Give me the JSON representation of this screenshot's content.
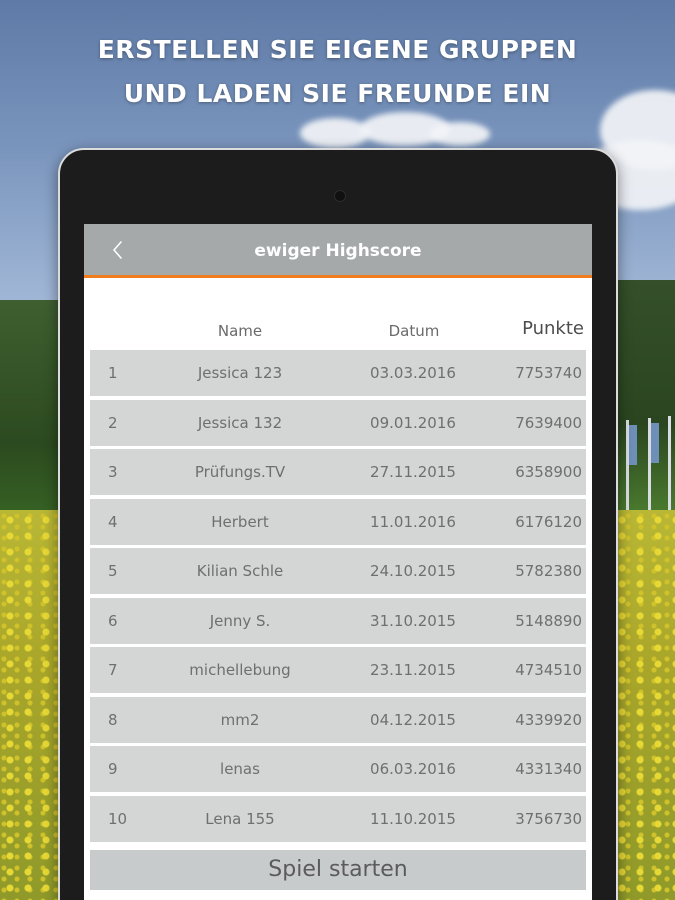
{
  "headline": {
    "line1": "ERSTELLEN SIE EIGENE GRUPPEN",
    "line2": "UND LADEN SIE FREUNDE EIN"
  },
  "appbar": {
    "title": "ewiger Highscore",
    "back_icon": "chevron-left-icon"
  },
  "table": {
    "columns": {
      "name": "Name",
      "date": "Datum",
      "points": "Punkte"
    },
    "rows": [
      {
        "rank": "1",
        "name": "Jessica 123",
        "date": "03.03.2016",
        "points": "7753740"
      },
      {
        "rank": "2",
        "name": "Jessica 132",
        "date": "09.01.2016",
        "points": "7639400"
      },
      {
        "rank": "3",
        "name": "Prüfungs.TV",
        "date": "27.11.2015",
        "points": "6358900"
      },
      {
        "rank": "4",
        "name": "Herbert",
        "date": "11.01.2016",
        "points": "6176120"
      },
      {
        "rank": "5",
        "name": "Kilian Schle",
        "date": "24.10.2015",
        "points": "5782380"
      },
      {
        "rank": "6",
        "name": "Jenny S.",
        "date": "31.10.2015",
        "points": "5148890"
      },
      {
        "rank": "7",
        "name": "michellebung",
        "date": "23.11.2015",
        "points": "4734510"
      },
      {
        "rank": "8",
        "name": "mm2",
        "date": "04.12.2015",
        "points": "4339920"
      },
      {
        "rank": "9",
        "name": "lenas",
        "date": "06.03.2016",
        "points": "4331340"
      },
      {
        "rank": "10",
        "name": "Lena 155",
        "date": "11.10.2015",
        "points": "3756730"
      }
    ]
  },
  "start_button": {
    "label": "Spiel starten"
  },
  "colors": {
    "accent": "#f07c1e",
    "appbar": "#a5a9a9",
    "row": "#d4d6d6"
  }
}
